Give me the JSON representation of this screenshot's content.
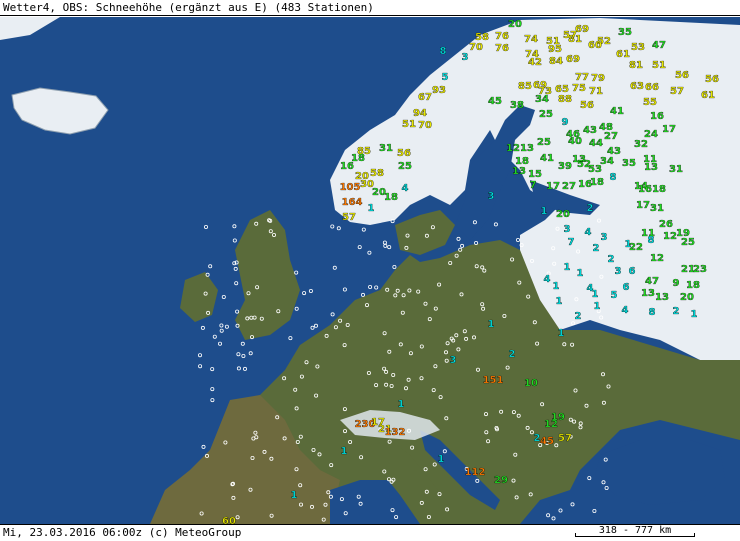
{
  "title": "Wetter4, OBS: Schneehöhe (ergänzt aus E) (483 Stationen)",
  "footer": {
    "timestamp": "Mi, 23.03.2016 06:00z (c) MeteoGroup",
    "scale_label": "318 - 777 km"
  },
  "legend_colors": {
    "low": "#22dd22",
    "mid": "#e8e800",
    "high": "#ff7a00",
    "shallow": "#00e0e0",
    "none": "#ffffff",
    "sea": "#1e4d8c",
    "land": "#5a6b3a",
    "snow": "#e9eef3"
  },
  "stations": [
    {
      "t": "20",
      "c": "low",
      "a": [
        515,
        23
      ]
    },
    {
      "t": "35",
      "c": "low",
      "a": [
        625,
        31
      ]
    },
    {
      "t": "47",
      "c": "low",
      "a": [
        659,
        44
      ]
    },
    {
      "t": "58",
      "c": "mid",
      "a": [
        482,
        36
      ]
    },
    {
      "t": "76",
      "c": "mid",
      "a": [
        502,
        35
      ]
    },
    {
      "t": "74",
      "c": "mid",
      "a": [
        531,
        38
      ]
    },
    {
      "t": "51",
      "c": "mid",
      "a": [
        553,
        40
      ]
    },
    {
      "t": "81",
      "c": "mid",
      "a": [
        575,
        38
      ]
    },
    {
      "t": "69",
      "c": "mid",
      "a": [
        582,
        28
      ]
    },
    {
      "t": "57",
      "c": "mid",
      "a": [
        570,
        34
      ]
    },
    {
      "t": "52",
      "c": "mid",
      "a": [
        604,
        40
      ]
    },
    {
      "t": "70",
      "c": "mid",
      "a": [
        476,
        46
      ]
    },
    {
      "t": "76",
      "c": "mid",
      "a": [
        502,
        47
      ]
    },
    {
      "t": "74",
      "c": "mid",
      "a": [
        532,
        53
      ]
    },
    {
      "t": "95",
      "c": "mid",
      "a": [
        555,
        48
      ]
    },
    {
      "t": "60",
      "c": "mid",
      "a": [
        595,
        44
      ]
    },
    {
      "t": "53",
      "c": "mid",
      "a": [
        638,
        46
      ]
    },
    {
      "t": "61",
      "c": "mid",
      "a": [
        623,
        53
      ]
    },
    {
      "t": "42",
      "c": "mid",
      "a": [
        535,
        61
      ]
    },
    {
      "t": "84",
      "c": "mid",
      "a": [
        556,
        60
      ]
    },
    {
      "t": "69",
      "c": "mid",
      "a": [
        573,
        58
      ]
    },
    {
      "t": "51",
      "c": "mid",
      "a": [
        659,
        64
      ]
    },
    {
      "t": "81",
      "c": "mid",
      "a": [
        636,
        64
      ]
    },
    {
      "t": "56",
      "c": "mid",
      "a": [
        682,
        74
      ]
    },
    {
      "t": "56",
      "c": "mid",
      "a": [
        712,
        78
      ]
    },
    {
      "t": "77",
      "c": "mid",
      "a": [
        582,
        76
      ]
    },
    {
      "t": "79",
      "c": "mid",
      "a": [
        598,
        77
      ]
    },
    {
      "t": "63",
      "c": "mid",
      "a": [
        637,
        85
      ]
    },
    {
      "t": "66",
      "c": "mid",
      "a": [
        652,
        86
      ]
    },
    {
      "t": "57",
      "c": "mid",
      "a": [
        677,
        90
      ]
    },
    {
      "t": "61",
      "c": "mid",
      "a": [
        708,
        94
      ]
    },
    {
      "t": "69",
      "c": "mid",
      "a": [
        540,
        84
      ]
    },
    {
      "t": "73",
      "c": "mid",
      "a": [
        545,
        90
      ]
    },
    {
      "t": "65",
      "c": "mid",
      "a": [
        562,
        88
      ]
    },
    {
      "t": "71",
      "c": "mid",
      "a": [
        596,
        90
      ]
    },
    {
      "t": "88",
      "c": "mid",
      "a": [
        565,
        98
      ]
    },
    {
      "t": "85",
      "c": "mid",
      "a": [
        525,
        85
      ]
    },
    {
      "t": "75",
      "c": "mid",
      "a": [
        579,
        87
      ]
    },
    {
      "t": "55",
      "c": "mid",
      "a": [
        650,
        101
      ]
    },
    {
      "t": "67",
      "c": "mid",
      "a": [
        425,
        96
      ]
    },
    {
      "t": "93",
      "c": "mid",
      "a": [
        439,
        89
      ]
    },
    {
      "t": "56",
      "c": "mid",
      "a": [
        587,
        104
      ]
    },
    {
      "t": "94",
      "c": "mid",
      "a": [
        420,
        112
      ]
    },
    {
      "t": "51",
      "c": "mid",
      "a": [
        409,
        123
      ]
    },
    {
      "t": "70",
      "c": "mid",
      "a": [
        425,
        124
      ]
    },
    {
      "t": "45",
      "c": "low",
      "a": [
        495,
        100
      ]
    },
    {
      "t": "38",
      "c": "low",
      "a": [
        517,
        104
      ]
    },
    {
      "t": "34",
      "c": "low",
      "a": [
        542,
        98
      ]
    },
    {
      "t": "41",
      "c": "low",
      "a": [
        617,
        110
      ]
    },
    {
      "t": "16",
      "c": "low",
      "a": [
        657,
        115
      ]
    },
    {
      "t": "17",
      "c": "low",
      "a": [
        669,
        128
      ]
    },
    {
      "t": "25",
      "c": "low",
      "a": [
        546,
        113
      ]
    },
    {
      "t": "9",
      "c": "shallow",
      "a": [
        565,
        121
      ]
    },
    {
      "t": "46",
      "c": "low",
      "a": [
        573,
        133
      ]
    },
    {
      "t": "43",
      "c": "low",
      "a": [
        590,
        129
      ]
    },
    {
      "t": "48",
      "c": "low",
      "a": [
        606,
        126
      ]
    },
    {
      "t": "27",
      "c": "low",
      "a": [
        611,
        135
      ]
    },
    {
      "t": "24",
      "c": "low",
      "a": [
        651,
        133
      ]
    },
    {
      "t": "32",
      "c": "low",
      "a": [
        641,
        143
      ]
    },
    {
      "t": "12",
      "c": "low",
      "a": [
        513,
        147
      ]
    },
    {
      "t": "13",
      "c": "low",
      "a": [
        527,
        147
      ]
    },
    {
      "t": "25",
      "c": "low",
      "a": [
        544,
        141
      ]
    },
    {
      "t": "40",
      "c": "low",
      "a": [
        575,
        140
      ]
    },
    {
      "t": "44",
      "c": "low",
      "a": [
        596,
        142
      ]
    },
    {
      "t": "43",
      "c": "low",
      "a": [
        614,
        150
      ]
    },
    {
      "t": "41",
      "c": "low",
      "a": [
        547,
        157
      ]
    },
    {
      "t": "13",
      "c": "low",
      "a": [
        579,
        158
      ]
    },
    {
      "t": "52",
      "c": "low",
      "a": [
        584,
        163
      ]
    },
    {
      "t": "34",
      "c": "low",
      "a": [
        607,
        160
      ]
    },
    {
      "t": "35",
      "c": "low",
      "a": [
        629,
        162
      ]
    },
    {
      "t": "11",
      "c": "low",
      "a": [
        650,
        158
      ]
    },
    {
      "t": "13",
      "c": "low",
      "a": [
        651,
        166
      ]
    },
    {
      "t": "31",
      "c": "low",
      "a": [
        676,
        168
      ]
    },
    {
      "t": "18",
      "c": "low",
      "a": [
        522,
        160
      ]
    },
    {
      "t": "13",
      "c": "low",
      "a": [
        519,
        170
      ]
    },
    {
      "t": "15",
      "c": "low",
      "a": [
        535,
        173
      ]
    },
    {
      "t": "39",
      "c": "low",
      "a": [
        565,
        165
      ]
    },
    {
      "t": "53",
      "c": "low",
      "a": [
        595,
        168
      ]
    },
    {
      "t": "8",
      "c": "shallow",
      "a": [
        613,
        176
      ]
    },
    {
      "t": "17",
      "c": "low",
      "a": [
        553,
        185
      ]
    },
    {
      "t": "27",
      "c": "low",
      "a": [
        569,
        185
      ]
    },
    {
      "t": "16",
      "c": "low",
      "a": [
        585,
        183
      ]
    },
    {
      "t": "7",
      "c": "low",
      "a": [
        533,
        184
      ]
    },
    {
      "t": "18",
      "c": "low",
      "a": [
        597,
        181
      ]
    },
    {
      "t": "14",
      "c": "low",
      "a": [
        641,
        185
      ]
    },
    {
      "t": "16",
      "c": "low",
      "a": [
        645,
        188
      ]
    },
    {
      "t": "18",
      "c": "low",
      "a": [
        659,
        188
      ]
    },
    {
      "t": "3",
      "c": "shallow",
      "a": [
        491,
        195
      ]
    },
    {
      "t": "1",
      "c": "shallow",
      "a": [
        544,
        210
      ]
    },
    {
      "t": "20",
      "c": "low",
      "a": [
        563,
        213
      ]
    },
    {
      "t": "2",
      "c": "shallow",
      "a": [
        590,
        207
      ]
    },
    {
      "t": "17",
      "c": "low",
      "a": [
        643,
        204
      ]
    },
    {
      "t": "31",
      "c": "low",
      "a": [
        657,
        207
      ]
    },
    {
      "t": "26",
      "c": "low",
      "a": [
        666,
        223
      ]
    },
    {
      "t": "11",
      "c": "low",
      "a": [
        648,
        232
      ]
    },
    {
      "t": "12",
      "c": "low",
      "a": [
        670,
        235
      ]
    },
    {
      "t": "19",
      "c": "low",
      "a": [
        683,
        232
      ]
    },
    {
      "t": "25",
      "c": "low",
      "a": [
        688,
        241
      ]
    },
    {
      "t": "22",
      "c": "low",
      "a": [
        636,
        246
      ]
    },
    {
      "t": "3",
      "c": "shallow",
      "a": [
        567,
        228
      ]
    },
    {
      "t": "4",
      "c": "shallow",
      "a": [
        588,
        231
      ]
    },
    {
      "t": "3",
      "c": "shallow",
      "a": [
        604,
        236
      ]
    },
    {
      "t": "1",
      "c": "shallow",
      "a": [
        628,
        243
      ]
    },
    {
      "t": "8",
      "c": "shallow",
      "a": [
        651,
        239
      ]
    },
    {
      "t": "7",
      "c": "shallow",
      "a": [
        571,
        241
      ]
    },
    {
      "t": "2",
      "c": "shallow",
      "a": [
        596,
        247
      ]
    },
    {
      "t": "2",
      "c": "shallow",
      "a": [
        611,
        258
      ]
    },
    {
      "t": "12",
      "c": "low",
      "a": [
        657,
        257
      ]
    },
    {
      "t": "1",
      "c": "shallow",
      "a": [
        567,
        266
      ]
    },
    {
      "t": "3",
      "c": "shallow",
      "a": [
        618,
        270
      ]
    },
    {
      "t": "6",
      "c": "shallow",
      "a": [
        632,
        270
      ]
    },
    {
      "t": "21",
      "c": "low",
      "a": [
        688,
        268
      ]
    },
    {
      "t": "23",
      "c": "low",
      "a": [
        700,
        268
      ]
    },
    {
      "t": "1",
      "c": "shallow",
      "a": [
        580,
        272
      ]
    },
    {
      "t": "4",
      "c": "shallow",
      "a": [
        547,
        278
      ]
    },
    {
      "t": "1",
      "c": "shallow",
      "a": [
        556,
        285
      ]
    },
    {
      "t": "4",
      "c": "shallow",
      "a": [
        590,
        287
      ]
    },
    {
      "t": "6",
      "c": "shallow",
      "a": [
        626,
        286
      ]
    },
    {
      "t": "47",
      "c": "low",
      "a": [
        652,
        280
      ]
    },
    {
      "t": "9",
      "c": "low",
      "a": [
        676,
        282
      ]
    },
    {
      "t": "18",
      "c": "low",
      "a": [
        693,
        284
      ]
    },
    {
      "t": "1",
      "c": "shallow",
      "a": [
        595,
        293
      ]
    },
    {
      "t": "5",
      "c": "shallow",
      "a": [
        614,
        294
      ]
    },
    {
      "t": "13",
      "c": "low",
      "a": [
        648,
        292
      ]
    },
    {
      "t": "13",
      "c": "low",
      "a": [
        662,
        296
      ]
    },
    {
      "t": "20",
      "c": "low",
      "a": [
        687,
        296
      ]
    },
    {
      "t": "1",
      "c": "shallow",
      "a": [
        559,
        300
      ]
    },
    {
      "t": "1",
      "c": "shallow",
      "a": [
        597,
        305
      ]
    },
    {
      "t": "4",
      "c": "shallow",
      "a": [
        625,
        309
      ]
    },
    {
      "t": "8",
      "c": "shallow",
      "a": [
        652,
        311
      ]
    },
    {
      "t": "2",
      "c": "shallow",
      "a": [
        676,
        310
      ]
    },
    {
      "t": "1",
      "c": "shallow",
      "a": [
        694,
        313
      ]
    },
    {
      "t": "2",
      "c": "shallow",
      "a": [
        578,
        315
      ]
    },
    {
      "t": "1",
      "c": "shallow",
      "a": [
        561,
        332
      ]
    },
    {
      "t": "1",
      "c": "shallow",
      "a": [
        491,
        323
      ]
    },
    {
      "t": "2",
      "c": "shallow",
      "a": [
        512,
        353
      ]
    },
    {
      "t": "3",
      "c": "shallow",
      "a": [
        453,
        359
      ]
    },
    {
      "t": "151",
      "c": "high",
      "a": [
        493,
        379
      ]
    },
    {
      "t": "10",
      "c": "low",
      "a": [
        531,
        382
      ]
    },
    {
      "t": "1",
      "c": "shallow",
      "a": [
        401,
        403
      ]
    },
    {
      "t": "19",
      "c": "low",
      "a": [
        558,
        416
      ]
    },
    {
      "t": "12",
      "c": "low",
      "a": [
        551,
        423
      ]
    },
    {
      "t": "45",
      "c": "high",
      "a": [
        547,
        440
      ]
    },
    {
      "t": "57",
      "c": "mid",
      "a": [
        565,
        437
      ]
    },
    {
      "t": "2",
      "c": "shallow",
      "a": [
        537,
        437
      ]
    },
    {
      "t": "230",
      "c": "high",
      "a": [
        365,
        423
      ]
    },
    {
      "t": "17",
      "c": "mid",
      "a": [
        378,
        421
      ]
    },
    {
      "t": "21",
      "c": "mid",
      "a": [
        385,
        428
      ]
    },
    {
      "t": "132",
      "c": "high",
      "a": [
        395,
        431
      ]
    },
    {
      "t": "1",
      "c": "shallow",
      "a": [
        344,
        450
      ]
    },
    {
      "t": "1",
      "c": "shallow",
      "a": [
        441,
        458
      ]
    },
    {
      "t": "112",
      "c": "high",
      "a": [
        475,
        471
      ]
    },
    {
      "t": "29",
      "c": "low",
      "a": [
        501,
        479
      ]
    },
    {
      "t": "1",
      "c": "shallow",
      "a": [
        294,
        494
      ]
    },
    {
      "t": "60",
      "c": "mid",
      "a": [
        229,
        520
      ]
    },
    {
      "t": "8",
      "c": "shallow",
      "a": [
        443,
        50
      ]
    },
    {
      "t": "3",
      "c": "shallow",
      "a": [
        465,
        56
      ]
    },
    {
      "t": "5",
      "c": "shallow",
      "a": [
        445,
        76
      ]
    },
    {
      "t": "85",
      "c": "mid",
      "a": [
        364,
        150
      ]
    },
    {
      "t": "31",
      "c": "low",
      "a": [
        386,
        147
      ]
    },
    {
      "t": "56",
      "c": "mid",
      "a": [
        404,
        152
      ]
    },
    {
      "t": "18",
      "c": "low",
      "a": [
        358,
        157
      ]
    },
    {
      "t": "25",
      "c": "low",
      "a": [
        405,
        165
      ]
    },
    {
      "t": "16",
      "c": "low",
      "a": [
        347,
        165
      ]
    },
    {
      "t": "20",
      "c": "mid",
      "a": [
        362,
        175
      ]
    },
    {
      "t": "58",
      "c": "mid",
      "a": [
        377,
        172
      ]
    },
    {
      "t": "30",
      "c": "mid",
      "a": [
        367,
        183
      ]
    },
    {
      "t": "105",
      "c": "high",
      "a": [
        350,
        186
      ]
    },
    {
      "t": "20",
      "c": "low",
      "a": [
        379,
        191
      ]
    },
    {
      "t": "18",
      "c": "low",
      "a": [
        391,
        196
      ]
    },
    {
      "t": "4",
      "c": "shallow",
      "a": [
        405,
        187
      ]
    },
    {
      "t": "164",
      "c": "high",
      "a": [
        352,
        201
      ]
    },
    {
      "t": "57",
      "c": "mid",
      "a": [
        349,
        216
      ]
    },
    {
      "t": "1",
      "c": "shallow",
      "a": [
        371,
        207
      ]
    }
  ]
}
